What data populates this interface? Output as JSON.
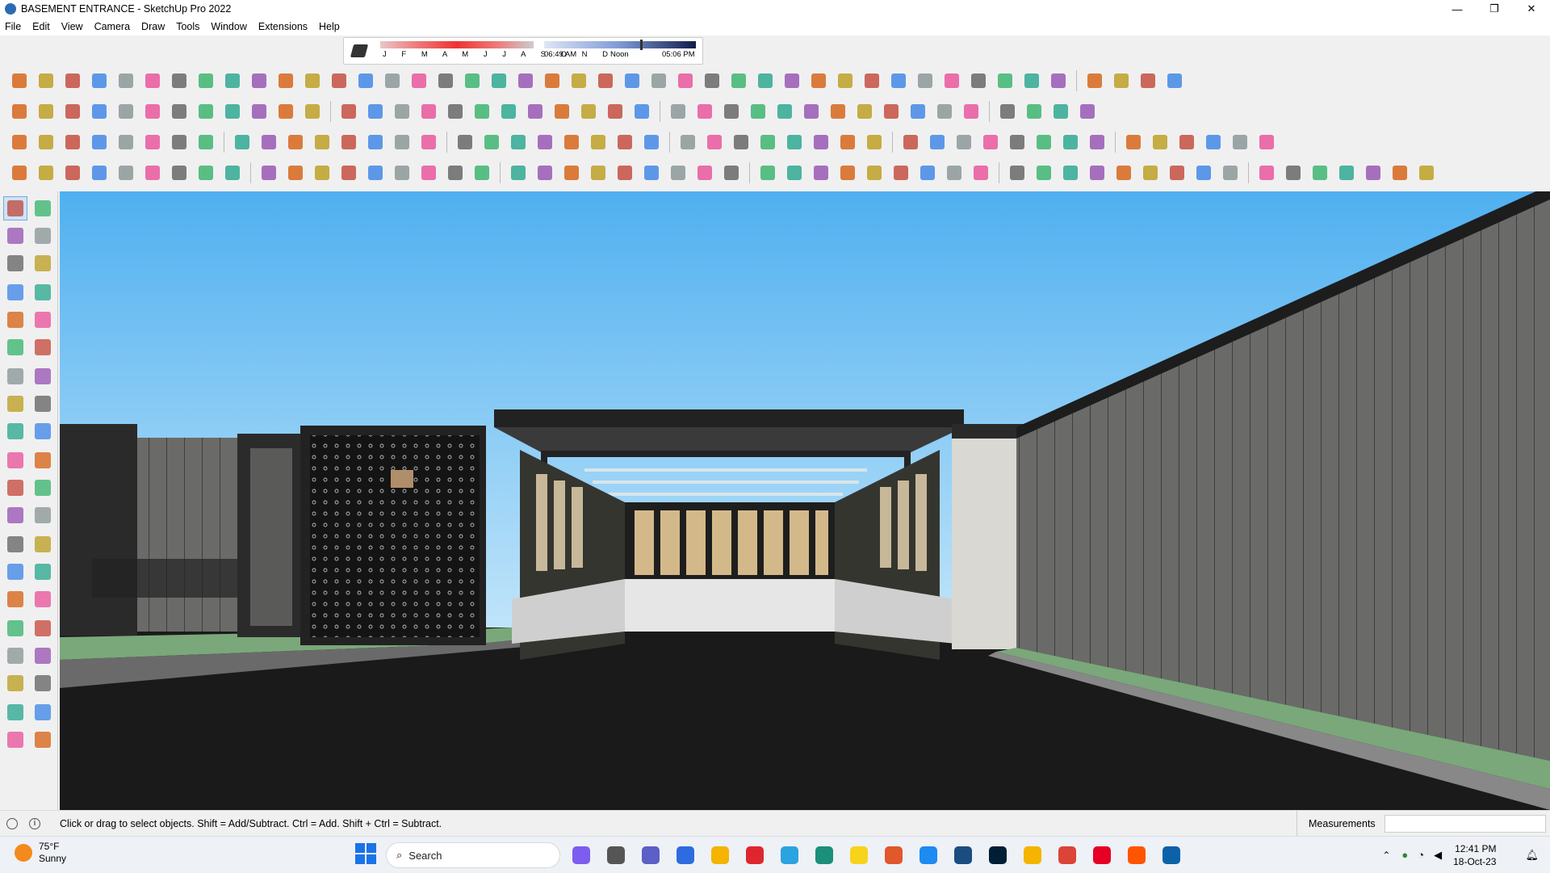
{
  "window": {
    "title": "BASEMENT ENTRANCE - SketchUp Pro 2022",
    "minimize": "—",
    "maximize": "❐",
    "close": "✕"
  },
  "menu": [
    "File",
    "Edit",
    "View",
    "Camera",
    "Draw",
    "Tools",
    "Window",
    "Extensions",
    "Help"
  ],
  "shadows": {
    "months": "J F M A M J J A S O N D",
    "time_start": "06:49 AM",
    "time_mid": "Noon",
    "time_end": "05:06 PM"
  },
  "status": {
    "message": "Click or drag to select objects. Shift = Add/Subtract. Ctrl = Add. Shift + Ctrl = Subtract.",
    "info_icon": "i",
    "measurements_label": "Measurements",
    "measurements_value": ""
  },
  "taskbar": {
    "weather_temp": "75°F",
    "weather_desc": "Sunny",
    "search_label": "Search",
    "time": "12:41 PM",
    "date": "18-Oct-23",
    "apps": [
      {
        "name": "copilot-icon",
        "color": "#7d5cf0"
      },
      {
        "name": "task-view-icon",
        "color": "#555"
      },
      {
        "name": "teams-icon",
        "color": "#5b5fc7"
      },
      {
        "name": "calculator-icon",
        "color": "#2d6cdf"
      },
      {
        "name": "file-explorer-icon",
        "color": "#f4b400"
      },
      {
        "name": "opera-icon",
        "color": "#e0262d"
      },
      {
        "name": "telegram-icon",
        "color": "#2aa3e0"
      },
      {
        "name": "app-icon",
        "color": "#1b8f7a"
      },
      {
        "name": "sticky-notes-icon",
        "color": "#f7d31a"
      },
      {
        "name": "grammarly-icon",
        "color": "#e0582b"
      },
      {
        "name": "snipping-tool-icon",
        "color": "#1d8bf1"
      },
      {
        "name": "app2-icon",
        "color": "#1a4d80"
      },
      {
        "name": "photoshop-icon",
        "color": "#001e36"
      },
      {
        "name": "drive-icon",
        "color": "#f4b400"
      },
      {
        "name": "chrome-icon",
        "color": "#db4437"
      },
      {
        "name": "pinterest-icon",
        "color": "#e60023"
      },
      {
        "name": "soundcloud-icon",
        "color": "#ff5500"
      },
      {
        "name": "sketchup-icon",
        "color": "#0b62a8"
      }
    ]
  },
  "colors": {
    "sky_top": "#5fb6f2",
    "sky_bottom": "#bde3f9",
    "wall": "#5a5a58",
    "ground": "#1b1b1b"
  }
}
